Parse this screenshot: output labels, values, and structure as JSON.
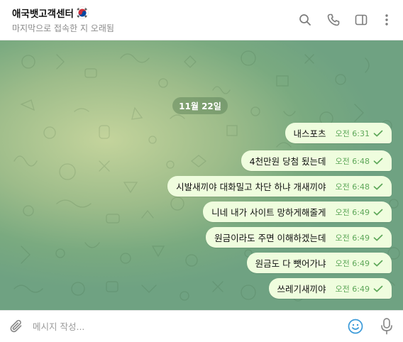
{
  "header": {
    "chat_name": "애국뱃고객센터",
    "status": "마지막으로 접속한 지 오래됨"
  },
  "chat": {
    "date_label": "11월 22일",
    "messages": [
      {
        "text": "내스포츠",
        "time": "오전 6:31"
      },
      {
        "text": "4천만원 당첨 됬는데",
        "time": "오전 6:48"
      },
      {
        "text": "시발새끼야 대화밀고 차단 하냐 개새끼야",
        "time": "오전 6:48"
      },
      {
        "text": "니네 내가 사이트 망하게해줄게",
        "time": "오전 6:49"
      },
      {
        "text": "원금이라도 주면 이해하겠는데",
        "time": "오전 6:49"
      },
      {
        "text": "원금도 다 뺏어가냐",
        "time": "오전 6:49"
      },
      {
        "text": "쓰레기새끼야",
        "time": "오전 6:49"
      }
    ]
  },
  "composer": {
    "placeholder": "메시지 작성..."
  },
  "icons": {
    "title_emoji": "south-korea-flag-icon",
    "header": [
      "search-icon",
      "phone-icon",
      "sidebar-toggle-icon",
      "more-vertical-icon"
    ],
    "message_status": "sent-check-icon",
    "composer": [
      "paperclip-icon",
      "emoji-icon",
      "microphone-icon"
    ]
  },
  "colors": {
    "bubble": "#effdde",
    "time_and_tick": "#5da758",
    "accent": "#3a9ad9",
    "date_pill": "#6e8f68"
  }
}
